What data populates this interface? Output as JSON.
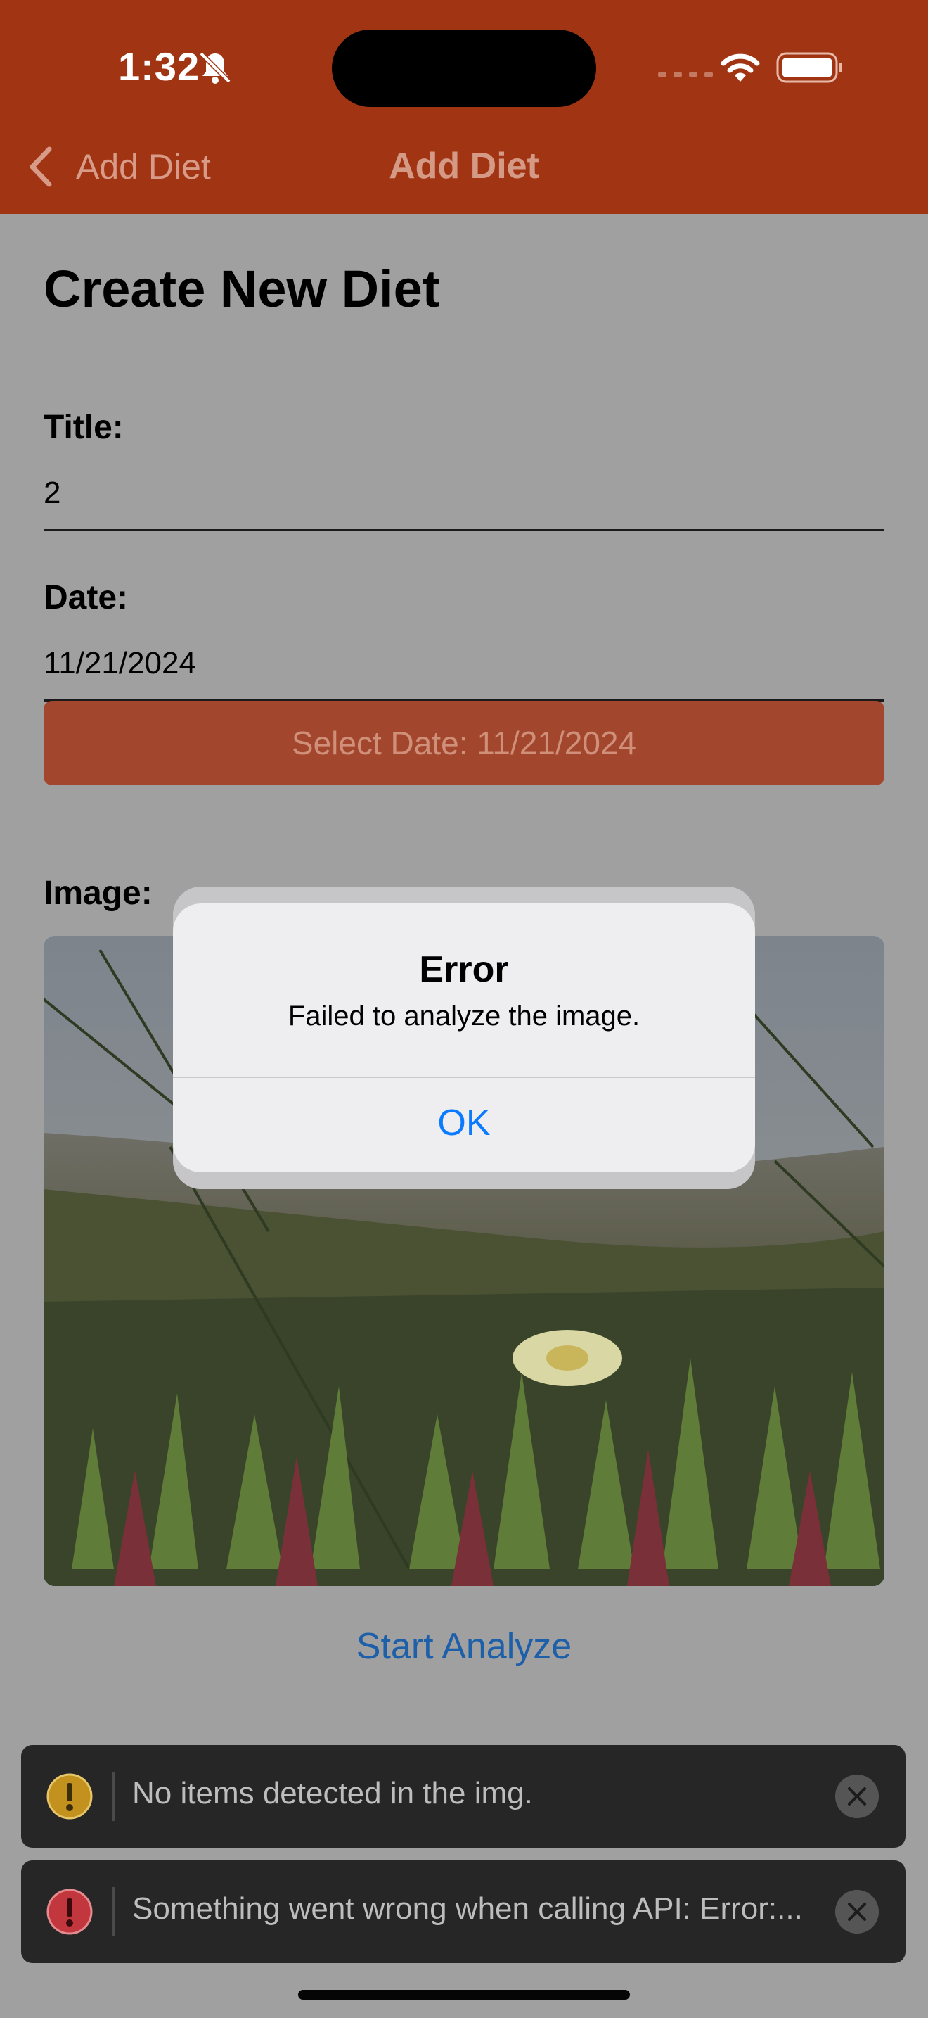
{
  "status_bar": {
    "time": "1:32"
  },
  "nav": {
    "back_label": "Add Diet",
    "title": "Add Diet"
  },
  "form": {
    "heading": "Create New Diet",
    "title_label": "Title:",
    "title_value": "2",
    "date_label": "Date:",
    "date_value": "11/21/2024",
    "select_date_label": "Select Date: 11/21/2024",
    "image_label": "Image:",
    "start_analyze_label": "Start Analyze"
  },
  "alert": {
    "title": "Error",
    "message": "Failed to analyze the image.",
    "ok_label": "OK"
  },
  "toasts": [
    {
      "type": "warning",
      "text": "No items detected in the img.",
      "icon_color": "#c2911e"
    },
    {
      "type": "error",
      "text": "Something went wrong when calling API:  Error:...",
      "icon_color": "#c1373d"
    }
  ],
  "colors": {
    "nav_bg": "#a13413",
    "select_date_bg": "#a2472d",
    "link_blue": "#1d5fa8",
    "alert_ok": "#0a7aff"
  }
}
